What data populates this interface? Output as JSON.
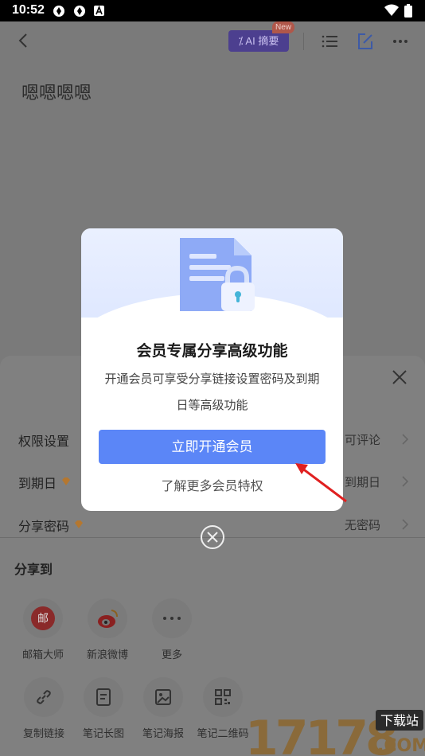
{
  "status_bar": {
    "time": "10:52"
  },
  "header": {
    "ai_summary_label": "AI 摘要",
    "new_tag": "New"
  },
  "document": {
    "title": "嗯嗯嗯嗯"
  },
  "share_sheet": {
    "settings": [
      {
        "label": "权限设置",
        "value": "可评论",
        "premium": false
      },
      {
        "label": "到期日",
        "value": "到期日",
        "premium": true
      },
      {
        "label": "分享密码",
        "value": "无密码",
        "premium": true
      }
    ],
    "share_to_label": "分享到",
    "share_targets_row1": [
      {
        "label": "邮箱大师",
        "icon": "mail-master-icon"
      },
      {
        "label": "新浪微博",
        "icon": "weibo-icon"
      },
      {
        "label": "更多",
        "icon": "more-dots-icon"
      }
    ],
    "share_targets_row2": [
      {
        "label": "复制链接",
        "icon": "link-icon"
      },
      {
        "label": "笔记长图",
        "icon": "long-image-icon"
      },
      {
        "label": "笔记海报",
        "icon": "poster-icon"
      },
      {
        "label": "笔记二维码",
        "icon": "qrcode-icon"
      }
    ]
  },
  "modal": {
    "title": "会员专属分享高级功能",
    "description": "开通会员可享受分享链接设置密码及到期日等高级功能",
    "cta_label": "立即开通会员",
    "learn_more_label": "了解更多会员特权"
  },
  "watermark": {
    "text": "17178",
    "domain": ".COM",
    "tagline": "下载站"
  },
  "colors": {
    "cta": "#5b86f7",
    "ai_badge": "#4c3f8f",
    "arrow": "#e02020",
    "weibo": "#e6162d",
    "mail": "#d9252a"
  }
}
